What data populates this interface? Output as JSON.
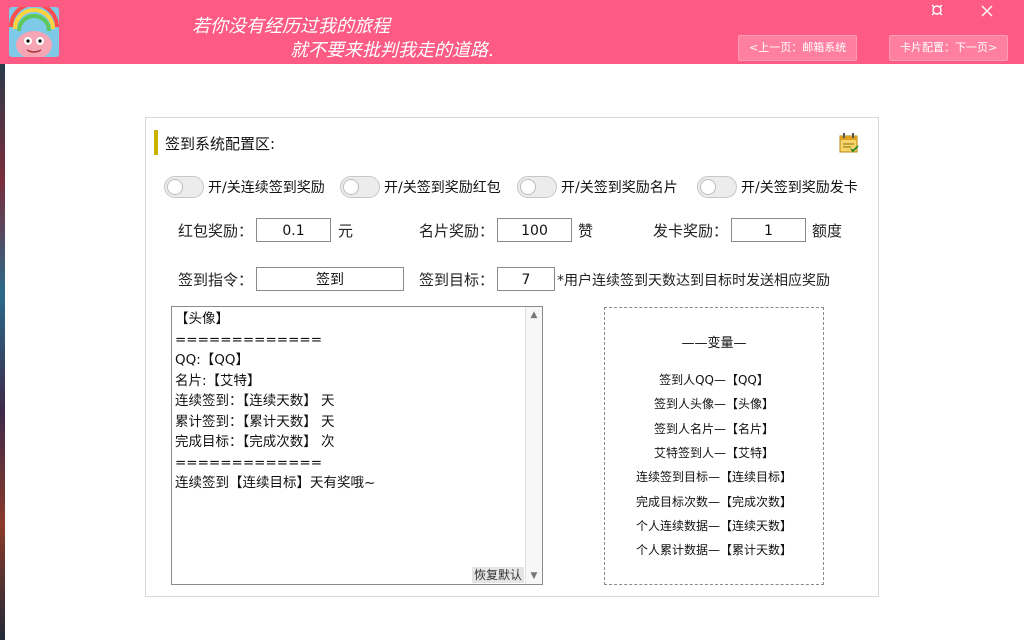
{
  "header": {
    "slogan_line1": "若你没有经历过我的旅程",
    "slogan_line2": "就不要来批判我走的道路.",
    "pin_icon": "pin-icon",
    "close_icon": "close-icon",
    "prev_button": "<上一页：邮箱系统",
    "next_button": "卡片配置：下一页>",
    "accent_color": "#fd5a84"
  },
  "panel": {
    "title": "签到系统配置区:",
    "toggles": [
      "开/关连续签到奖励",
      "开/关签到奖励红包",
      "开/关签到奖励名片",
      "开/关签到奖励发卡"
    ],
    "redpacket_label": "红包奖励：",
    "redpacket_value": "0.1",
    "redpacket_unit": "元",
    "card_label": "名片奖励：",
    "card_value": "100",
    "card_unit": "赞",
    "issue_label": "发卡奖励：",
    "issue_value": "1",
    "issue_unit": "额度",
    "command_label": "签到指令：",
    "command_value": "签到",
    "target_label": "签到目标：",
    "target_value": "7",
    "target_note": "*用户连续签到天数达到目标时发送相应奖励",
    "template_lines": [
      "【头像】",
      "=============",
      "QQ:【QQ】",
      "名片:【艾特】",
      "连续签到：【连续天数】 天",
      "累计签到：【累计天数】 天",
      "完成目标：【完成次数】 次",
      "=============",
      "连续签到【连续目标】天有奖哦~"
    ],
    "restore_label": "恢复默认",
    "vars_title": "——变量—",
    "vars": [
      "签到人QQ—【QQ】",
      "签到人头像—【头像】",
      "签到人名片—【名片】",
      "艾特签到人—【艾特】",
      "连续签到目标—【连续目标】",
      "完成目标次数—【完成次数】",
      "个人连续数据—【连续天数】",
      "个人累计数据—【累计天数】"
    ]
  }
}
